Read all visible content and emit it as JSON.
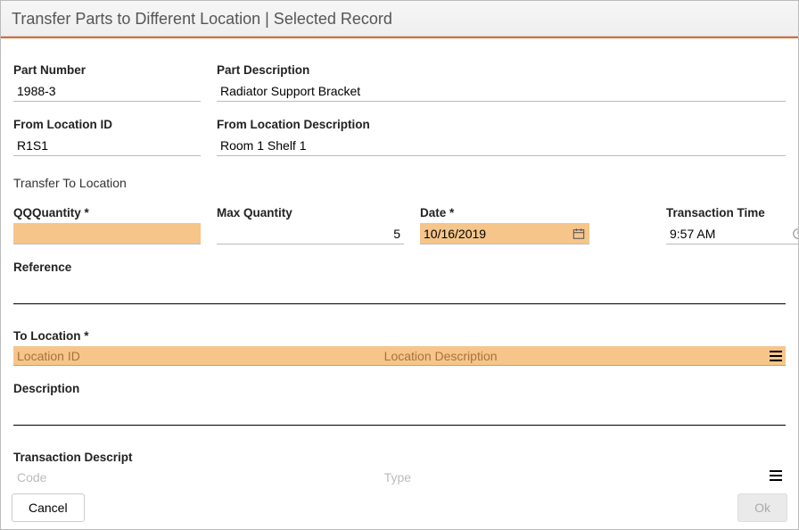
{
  "title": "Transfer Parts to Different Location | Selected Record",
  "part": {
    "number_label": "Part Number",
    "number_value": "1988-3",
    "desc_label": "Part Description",
    "desc_value": "Radiator Support Bracket"
  },
  "from": {
    "id_label": "From Location ID",
    "id_value": "R1S1",
    "desc_label": "From Location Description",
    "desc_value": "Room 1 Shelf 1"
  },
  "section_transfer_to": "Transfer To Location",
  "qty": {
    "label": "QQQuantity *",
    "value": ""
  },
  "maxqty": {
    "label": "Max Quantity",
    "value": "5"
  },
  "date": {
    "label": "Date *",
    "value": "10/16/2019"
  },
  "time": {
    "label": "Transaction Time",
    "value": "9:57 AM"
  },
  "reference": {
    "label": "Reference",
    "value": ""
  },
  "to_location": {
    "label": "To Location *",
    "col1": "Location ID",
    "col2": "Location Description"
  },
  "description": {
    "label": "Description",
    "value": ""
  },
  "tx_descript": {
    "label": "Transaction Descript",
    "col1": "Code",
    "col2": "Type"
  },
  "footer": {
    "cancel": "Cancel",
    "ok": "Ok"
  }
}
